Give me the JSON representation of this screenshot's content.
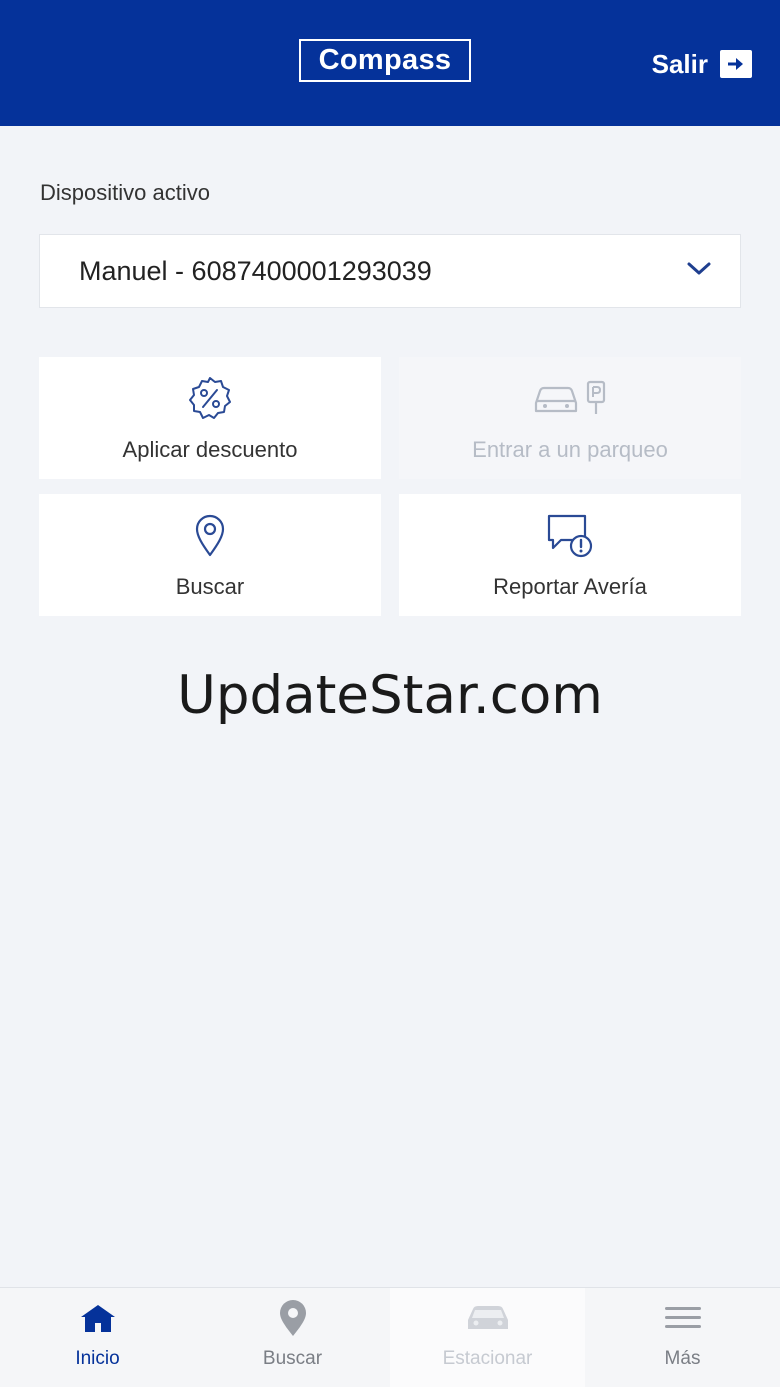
{
  "header": {
    "logo_text": "Compass",
    "logout_label": "Salir",
    "logout_icon": "arrow-right-box-icon",
    "background_color": "#05329a"
  },
  "device": {
    "label": "Dispositivo activo",
    "selected_value": "Manuel - 6087400001293039",
    "dropdown_icon": "chevron-down-icon"
  },
  "tiles": [
    {
      "label": "Aplicar descuento",
      "icon": "discount-badge-icon",
      "enabled": true
    },
    {
      "label": "Entrar a un parqueo",
      "icon": "car-parking-icon",
      "enabled": false
    },
    {
      "label": "Buscar",
      "icon": "location-pin-icon",
      "enabled": true
    },
    {
      "label": "Reportar Avería",
      "icon": "report-message-icon",
      "enabled": true
    }
  ],
  "watermark": "UpdateStar.com",
  "tabbar": {
    "items": [
      {
        "label": "Inicio",
        "icon": "home-icon",
        "active": true
      },
      {
        "label": "Buscar",
        "icon": "location-pin-icon",
        "active": false
      },
      {
        "label": "Estacionar",
        "icon": "car-icon",
        "active": false,
        "disabled": true
      },
      {
        "label": "Más",
        "icon": "menu-icon",
        "active": false
      }
    ]
  },
  "colors": {
    "accent": "#05329a",
    "icon_blue": "#1f3f8f",
    "disabled": "#b6bcc6"
  }
}
